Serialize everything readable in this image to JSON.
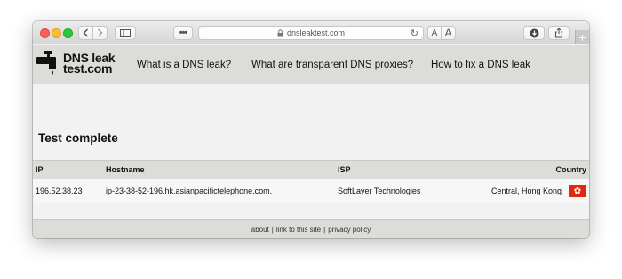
{
  "browser": {
    "url": "dnsleaktest.com",
    "more_label": "•••",
    "aa_small": "A",
    "aa_big": "A",
    "new_tab": "+"
  },
  "site": {
    "logo_line1": "DNS leak",
    "logo_line2": "test.com",
    "nav": [
      {
        "label": "What is a DNS leak?"
      },
      {
        "label": "What are transparent DNS proxies?"
      },
      {
        "label": "How to fix a DNS leak"
      }
    ]
  },
  "main": {
    "heading": "Test complete",
    "table": {
      "headers": {
        "ip": "IP",
        "hostname": "Hostname",
        "isp": "ISP",
        "country": "Country"
      },
      "rows": [
        {
          "ip": "196.52.38.23",
          "hostname": "ip-23-38-52-196.hk.asianpacifictelephone.com.",
          "isp": "SoftLayer Technologies",
          "country": "Central, Hong Kong",
          "flag": "hong-kong-flag"
        }
      ]
    }
  },
  "footer": {
    "about": "about",
    "link": "link to this site",
    "privacy": "privacy policy",
    "separator": "|"
  },
  "colors": {
    "header_bg": "#dcdcd8",
    "content_bg": "#f2f2f2",
    "flag_red": "#de2910"
  }
}
